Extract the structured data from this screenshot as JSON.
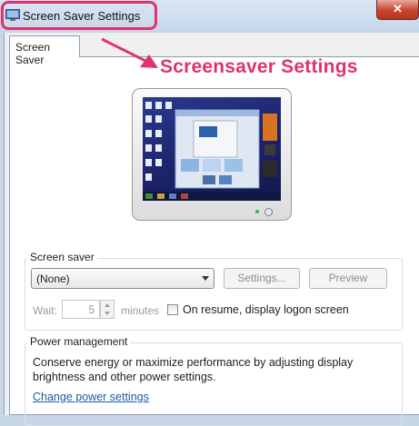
{
  "window": {
    "title": "Screen Saver Settings",
    "close_glyph": "✕"
  },
  "tabs": [
    {
      "label": "Screen Saver"
    }
  ],
  "annotation": {
    "callout": "Screensaver Settings",
    "color": "#e0336b"
  },
  "screen_saver": {
    "group_label": "Screen saver",
    "selected": "(None)",
    "settings_button": "Settings...",
    "preview_button": "Preview",
    "wait_label": "Wait:",
    "wait_value": "5",
    "minutes_label": "minutes",
    "resume_checkbox_label": "On resume, display logon screen",
    "resume_checked": false
  },
  "power_management": {
    "group_label": "Power management",
    "description": "Conserve energy or maximize performance by adjusting display brightness and other power settings.",
    "link": "Change power settings"
  },
  "colors": {
    "link": "#1c5ba6",
    "accent": "#e0336b"
  }
}
